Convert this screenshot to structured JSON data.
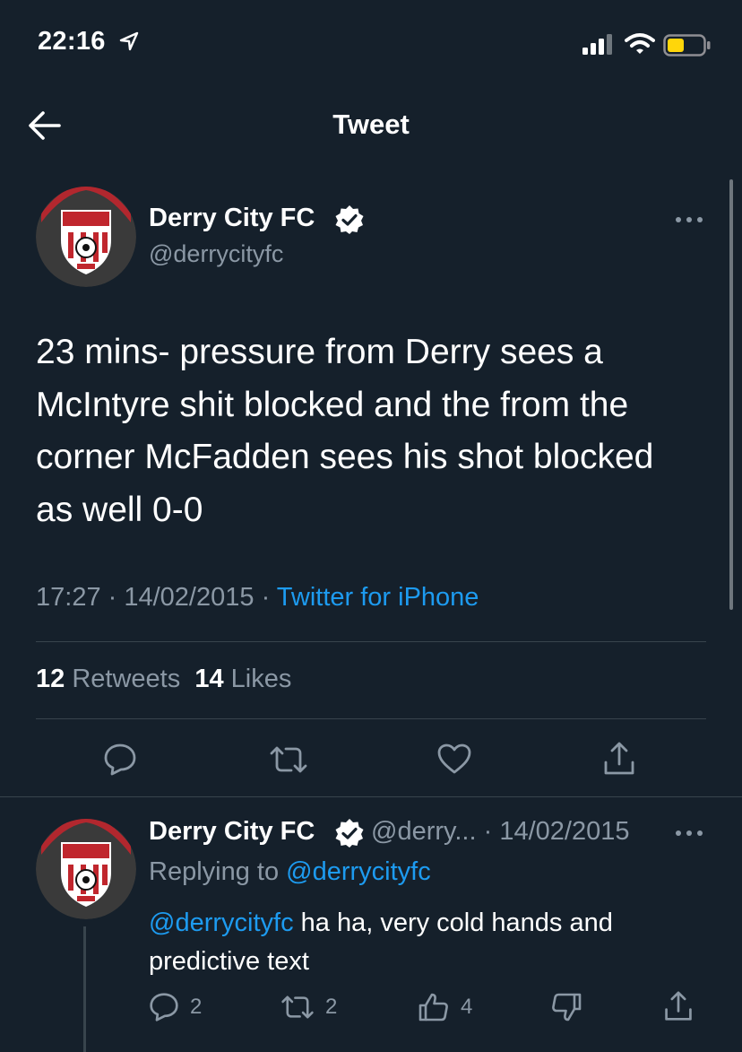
{
  "status_bar": {
    "time": "22:16"
  },
  "header": {
    "title": "Tweet"
  },
  "tweet": {
    "display_name": "Derry City FC",
    "handle": "@derrycityfc",
    "text": "23 mins- pressure from Derry sees a McIntyre shit blocked and the from the corner McFadden sees his shot blocked as well 0-0",
    "time": "17:27",
    "date": "14/02/2015",
    "source": "Twitter for iPhone",
    "sep": " · ",
    "retweets_count": "12",
    "retweets_label": "Retweets",
    "likes_count": "14",
    "likes_label": "Likes"
  },
  "reply": {
    "display_name": "Derry City FC",
    "handle_truncated": "@derry...",
    "sep": " · ",
    "date": "14/02/2015",
    "replying_to_label": "Replying to ",
    "replying_to_handle": "@derrycityfc",
    "mention": "@derrycityfc",
    "text": " ha ha, very cold hands and predictive text",
    "reply_count": "2",
    "retweet_count": "2",
    "like_count": "4"
  },
  "icons": {
    "back": "arrow-left-icon",
    "verified": "verified-badge-icon",
    "more": "more-horizontal-icon",
    "reply": "reply-bubble-icon",
    "retweet": "retweet-icon",
    "like": "heart-icon",
    "share": "share-icon",
    "thumbs_up": "thumbs-up-icon",
    "thumbs_down": "thumbs-down-icon"
  },
  "colors": {
    "background": "#15202b",
    "accent": "#1d9bf0",
    "muted": "#8b98a5",
    "divider": "#38444d",
    "battery": "#ffd60a"
  }
}
